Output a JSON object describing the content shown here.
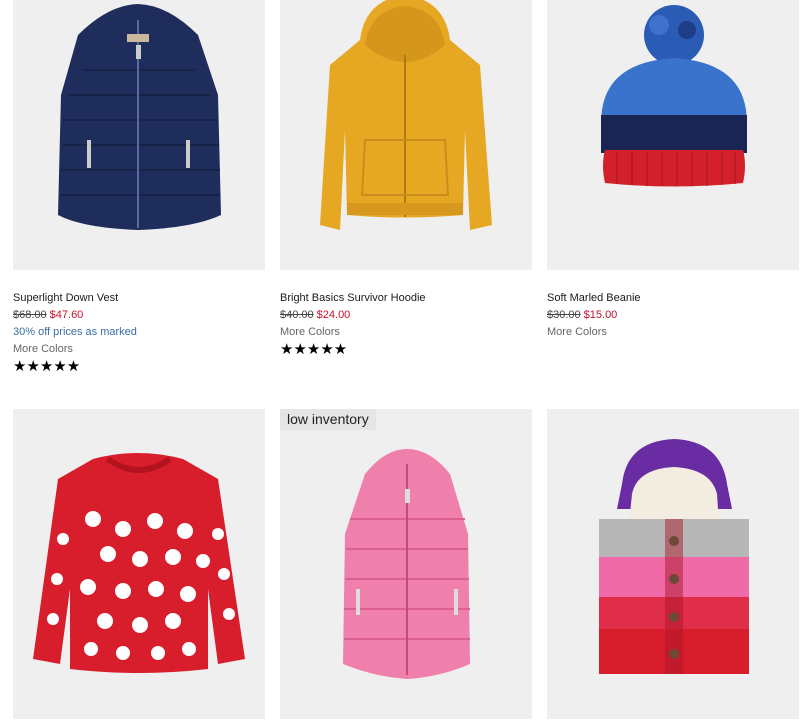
{
  "products": [
    {
      "name": "Superlight Down Vest",
      "was": "$68.00",
      "now": "$47.60",
      "promo": "30% off prices as marked",
      "more": "More Colors",
      "rating": 4.5,
      "stars": "★★★★★"
    },
    {
      "name": "Bright Basics Survivor Hoodie",
      "was": "$40.00",
      "now": "$24.00",
      "more": "More Colors",
      "rating": 4.5,
      "stars": "★★★★★"
    },
    {
      "name": "Soft Marled Beanie",
      "was": "$30.00",
      "now": "$15.00",
      "more": "More Colors"
    },
    {
      "badge": "low inventory"
    }
  ],
  "colors": {
    "sale_red": "#c8102e",
    "promo_blue": "#3a6ea5",
    "image_bg": "#efefef"
  }
}
